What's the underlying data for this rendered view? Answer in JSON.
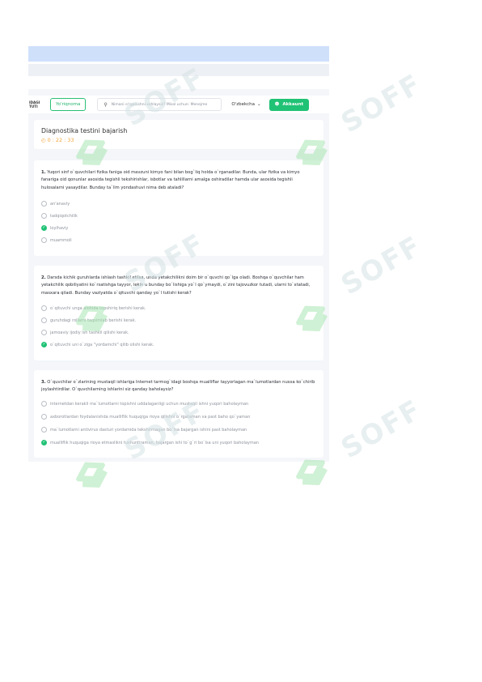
{
  "header": {
    "logo_text": "IDAGI\nTUTI",
    "guide_label": "Yo'riqnoma",
    "search_placeholder": "Nimani o'rganishni xohlaysiz? Misol uchun: Menejme",
    "language_label": "O'zbekcha",
    "account_label": "Akkaunt"
  },
  "test": {
    "title": "Diagnostika testini bajarish",
    "timer": "0 : 22 : 33"
  },
  "questions": [
    {
      "number": "1.",
      "text": "Yuqori sinf o`quvchilari fizika faniga oid mavzuni kimyo fani bilan bog`liq holda o`rganadilar. Bunda, ular fizika va kimyo fanariga oid qonunlar asosida tegishli tekshirishlar, isbotlar va tahlillarni amalga oshiradilar hamda ular asosida tegishli hulosalarni yasaydilar. Bunday ta`lim yondashuvi nima deb ataladi?",
      "options": [
        {
          "label": "an'anaviy",
          "selected": false
        },
        {
          "label": "tadqiqotchilik",
          "selected": false
        },
        {
          "label": "loyihaviy",
          "selected": true
        },
        {
          "label": "muammoli",
          "selected": false
        }
      ]
    },
    {
      "number": "2.",
      "text": "Darsda kichik guruhlarda ishlash tashkil etilsa, unda yetakchilikni doim bir o`quvchi qo`lga oladi. Boshqa o`quvchilar ham yetakchilik qobiliyatini ko`rsatishga tayyor, lekin u bunday bo`lishiga yo`l qo`ymaydi, o`zini tajovuzkor tutadi, ularni to`xtatadi, masxara qiladi. Bunday vaziyatda o`qituvchi qanday yo`l tutishi kerak?",
      "options": [
        {
          "label": "o`qituvchi unga alohida topshiriq berishi kerak.",
          "selected": false
        },
        {
          "label": "guruhdagi rollarni taqsimlab berishi kerak.",
          "selected": false
        },
        {
          "label": "jamoaviy ijodiy ish tashkil qilishi kerak.",
          "selected": false
        },
        {
          "label": "o`qituvchi uni o`ziga \"yordamchi\" qilib olishi kerak.",
          "selected": true
        }
      ]
    },
    {
      "number": "3.",
      "text": "O`quvchilar o`zlarining mustaqil ishlariga Internet tarmog`idagi boshqa mualliflar tayyorlagan ma`lumotlardan nusxa ko`chirib joylashtirdilar. O`quvchilarning ishlarini siz qanday baholaysiz?",
      "options": [
        {
          "label": "internetdan kerakli ma`lumotlarni topishni uddalaganligi uchun mustaqil ishni yuqori baholayman",
          "selected": false
        },
        {
          "label": "axborotlardan foydalanishda mualliflik huquqiga rioya qilishni o`rgataman va past baho qo`yaman",
          "selected": false
        },
        {
          "label": "ma`lumotlarni antivirus dasturi yordamida tekshirmagan bo`lsa bajargan ishini past baholayman",
          "selected": false
        },
        {
          "label": "mualliflik huquqiga rioya etmaslikni tushuntiraman, bajargan ishi to`g`ri bo`lsa uni yuqori baholayman",
          "selected": true
        }
      ]
    }
  ],
  "watermark": {
    "text": "SOFF"
  },
  "colors": {
    "accent": "#20c275",
    "timer": "#f2a43a",
    "band": "#cfe0fb"
  }
}
